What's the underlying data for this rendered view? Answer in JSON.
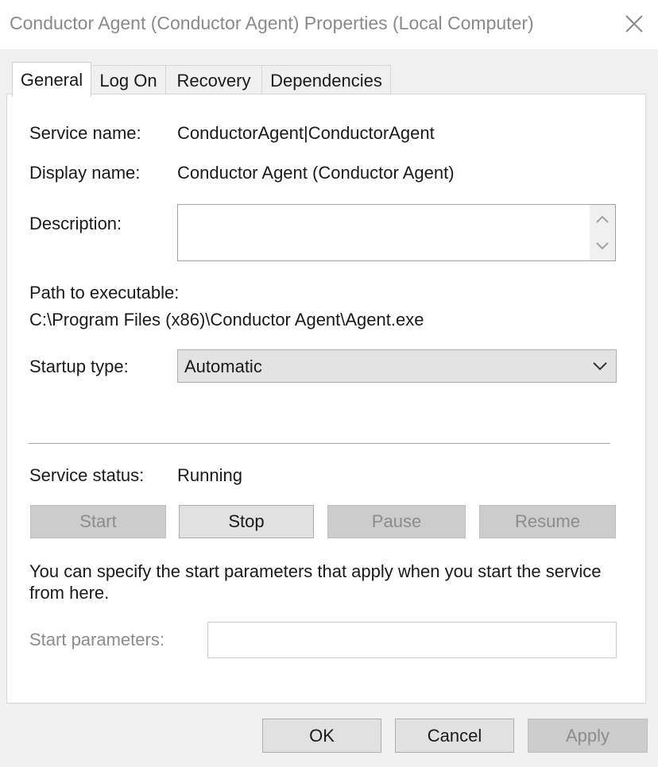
{
  "window": {
    "title": "Conductor Agent (Conductor Agent) Properties (Local Computer)"
  },
  "tabs": [
    {
      "label": "General",
      "active": true
    },
    {
      "label": "Log On",
      "active": false
    },
    {
      "label": "Recovery",
      "active": false
    },
    {
      "label": "Dependencies",
      "active": false
    }
  ],
  "general": {
    "service_name_label": "Service name:",
    "service_name_value": "ConductorAgent|ConductorAgent",
    "display_name_label": "Display name:",
    "display_name_value": "Conductor Agent (Conductor Agent)",
    "description_label": "Description:",
    "description_value": "",
    "path_label": "Path to executable:",
    "path_value": "C:\\Program Files (x86)\\Conductor Agent\\Agent.exe",
    "startup_type_label": "Startup type:",
    "startup_type_value": "Automatic",
    "service_status_label": "Service status:",
    "service_status_value": "Running",
    "buttons": {
      "start": "Start",
      "stop": "Stop",
      "pause": "Pause",
      "resume": "Resume"
    },
    "info_text": "You can specify the start parameters that apply when you start the service from here.",
    "start_parameters_label": "Start parameters:",
    "start_parameters_value": ""
  },
  "footer": {
    "ok": "OK",
    "cancel": "Cancel",
    "apply": "Apply"
  },
  "icons": {
    "close": "close-icon",
    "scroll_up": "chevron-up-icon",
    "scroll_down": "chevron-down-icon",
    "dropdown": "chevron-down-icon"
  }
}
